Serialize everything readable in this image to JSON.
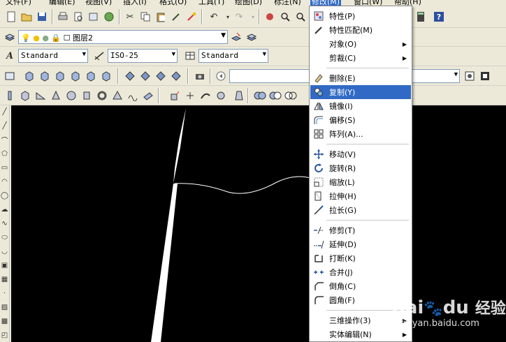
{
  "menubar": {
    "items": [
      "文件(F)",
      "编辑(E)",
      "视图(V)",
      "插入(I)",
      "格式(O)",
      "工具(T)",
      "绘图(D)",
      "标注(N)",
      "修改(M)",
      "窗口(W)",
      "帮助(H)"
    ]
  },
  "layer": {
    "name": "图层2"
  },
  "styles": {
    "text_style": "Standard",
    "dim_style": "ISO-25",
    "table_style": "Standard"
  },
  "modify_menu": {
    "items": [
      {
        "label": "特性(P)",
        "icon": "properties-icon"
      },
      {
        "label": "特性匹配(M)",
        "icon": "match-properties-brush-icon"
      },
      {
        "label": "对象(O)",
        "submenu": true
      },
      {
        "label": "剪裁(C)",
        "submenu": true
      },
      {
        "label": "删除(E)",
        "icon": "erase-eraser-icon"
      },
      {
        "label": "复制(Y)",
        "icon": "copy-circles-icon",
        "highlighted": true
      },
      {
        "label": "镜像(I)",
        "icon": "mirror-icon"
      },
      {
        "label": "偏移(S)",
        "icon": "offset-icon"
      },
      {
        "label": "阵列(A)...",
        "icon": "array-grid-icon"
      },
      {
        "label": "移动(V)",
        "icon": "move-cross-arrows-icon"
      },
      {
        "label": "旋转(R)",
        "icon": "rotate-icon"
      },
      {
        "label": "缩放(L)",
        "icon": "scale-icon"
      },
      {
        "label": "拉伸(H)",
        "icon": "stretch-icon"
      },
      {
        "label": "拉长(G)",
        "icon": "lengthen-icon"
      },
      {
        "label": "修剪(T)",
        "icon": "trim-icon"
      },
      {
        "label": "延伸(D)",
        "icon": "extend-icon"
      },
      {
        "label": "打断(K)",
        "icon": "break-icon"
      },
      {
        "label": "合并(J)",
        "icon": "join-icon"
      },
      {
        "label": "倒角(C)",
        "icon": "chamfer-icon"
      },
      {
        "label": "圆角(F)",
        "icon": "fillet-icon"
      },
      {
        "label": "三维操作(3)",
        "submenu": true
      },
      {
        "label": "实体编辑(N)",
        "submenu": true
      }
    ]
  },
  "watermark": {
    "brand": "Bai",
    "brand2": "du",
    "cn": "经验",
    "url": "jingyan.baidu.com"
  },
  "colors": {
    "highlight": "#316ac5",
    "canvas": "#000000",
    "chrome": "#ece9d8"
  }
}
